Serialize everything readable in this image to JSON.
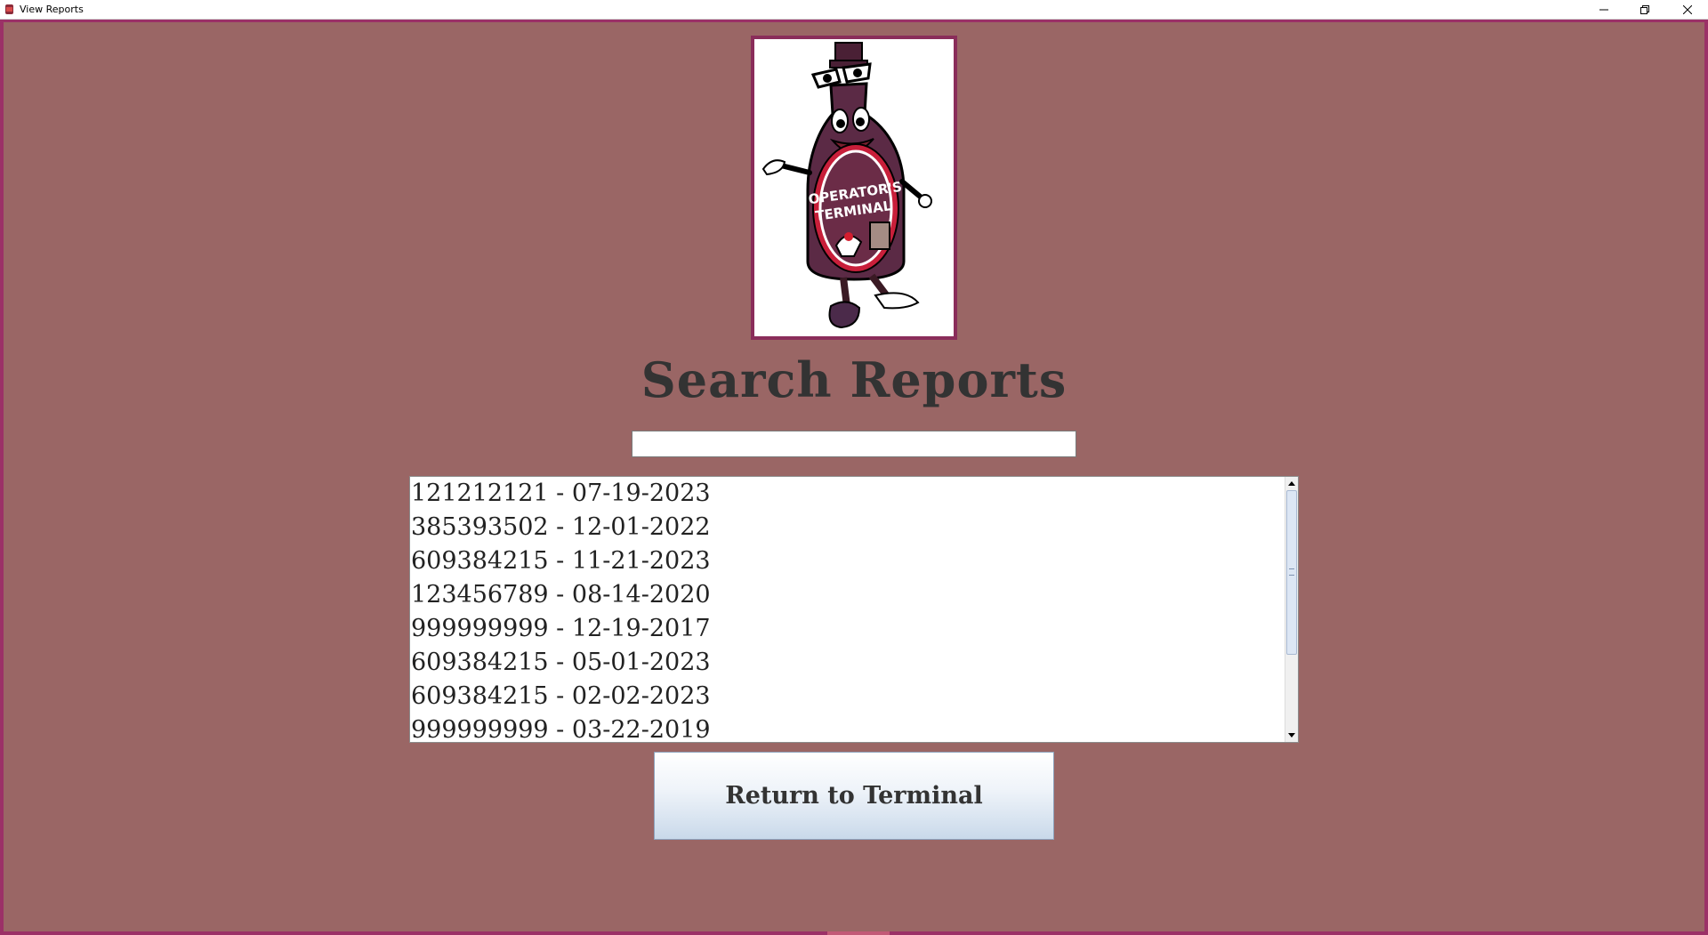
{
  "window": {
    "title": "View Reports",
    "minimize_icon": "minimize-icon",
    "restore_icon": "restore-icon",
    "close_icon": "close-icon"
  },
  "colors": {
    "background": "#9a6665",
    "border": "#9b3167",
    "title_text": "#333333"
  },
  "logo": {
    "icon": "operators-terminal-mascot-logo",
    "text_line1": "OPERATOR'S",
    "text_line2": "TERMINAL"
  },
  "main": {
    "title": "Search Reports",
    "search": {
      "value": "",
      "placeholder": ""
    },
    "reports": [
      "121212121 - 07-19-2023",
      "385393502 - 12-01-2022",
      "609384215 - 11-21-2023",
      "123456789 - 08-14-2020",
      "999999999 - 12-19-2017",
      "609384215 - 05-01-2023",
      "609384215 - 02-02-2023",
      "999999999 - 03-22-2019"
    ],
    "return_button_label": "Return to Terminal"
  }
}
